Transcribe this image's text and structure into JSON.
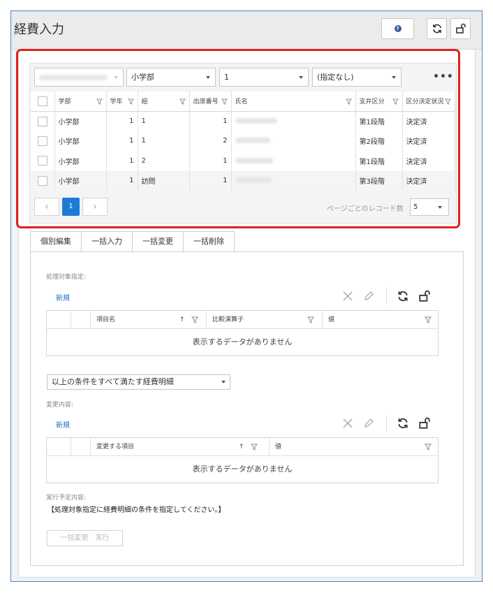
{
  "window": {
    "title": "経費入力"
  },
  "toolbar": {
    "help_icon_label": "?"
  },
  "filters": {
    "dept": "小学部",
    "grade": "1",
    "category": "(指定なし)",
    "more": "•••"
  },
  "grid": {
    "columns": [
      "学部",
      "学年",
      "組",
      "出席番号",
      "氏名",
      "支弁区分",
      "区分決定状況"
    ],
    "rows": [
      {
        "dept": "小学部",
        "grade": "1",
        "class": "1",
        "number": "1",
        "level": "第1段階",
        "status": "決定済"
      },
      {
        "dept": "小学部",
        "grade": "1",
        "class": "1",
        "number": "2",
        "level": "第2段階",
        "status": "決定済"
      },
      {
        "dept": "小学部",
        "grade": "1",
        "class": "2",
        "number": "1",
        "level": "第1段階",
        "status": "決定済"
      },
      {
        "dept": "小学部",
        "grade": "1",
        "class": "訪問",
        "number": "1",
        "level": "第3段階",
        "status": "決定済"
      }
    ]
  },
  "pager": {
    "prev": "‹",
    "current": "1",
    "next": "›",
    "rpp_label": "ページごとのレコード数",
    "rpp_value": "5"
  },
  "tabs": [
    "個別編集",
    "一括入力",
    "一括変更",
    "一括削除"
  ],
  "target": {
    "label": "処理対象指定:",
    "new_link": "新規",
    "columns": [
      "項目名",
      "比較演算子",
      "値"
    ],
    "empty": "表示するデータがありません"
  },
  "condition": {
    "value": "以上の条件をすべて満たす経費明細"
  },
  "change": {
    "label": "変更内容:",
    "new_link": "新規",
    "columns": [
      "変更する項目",
      "値"
    ],
    "empty": "表示するデータがありません"
  },
  "plan": {
    "label": "実行予定内容:",
    "text": "【処理対象指定に経費明細の条件を指定してください。】"
  },
  "exec_button": "一括変更　実行"
}
